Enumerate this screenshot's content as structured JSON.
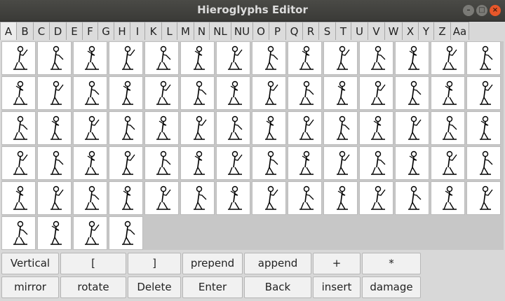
{
  "window": {
    "title": "Hieroglyphs Editor"
  },
  "window_buttons": [
    {
      "name": "minimize-button",
      "symbol": "–"
    },
    {
      "name": "maximize-button",
      "symbol": "□"
    },
    {
      "name": "close-button",
      "symbol": "×"
    }
  ],
  "tabs": [
    "A",
    "B",
    "C",
    "D",
    "E",
    "F",
    "G",
    "H",
    "I",
    "K",
    "L",
    "M",
    "N",
    "NL",
    "NU",
    "O",
    "P",
    "Q",
    "R",
    "S",
    "T",
    "U",
    "V",
    "W",
    "X",
    "Y",
    "Z",
    "Aa"
  ],
  "active_tab": "A",
  "glyph_grid": {
    "rows": 6,
    "columns": 14,
    "count": 74,
    "icon": "seated-man-hieroglyph"
  },
  "buttons_row1": [
    "Vertical",
    "[",
    "]",
    "prepend",
    "append",
    "+",
    "*"
  ],
  "buttons_row2": [
    "mirror",
    "rotate",
    "Delete",
    "Enter",
    "Back",
    "insert",
    "damage"
  ]
}
